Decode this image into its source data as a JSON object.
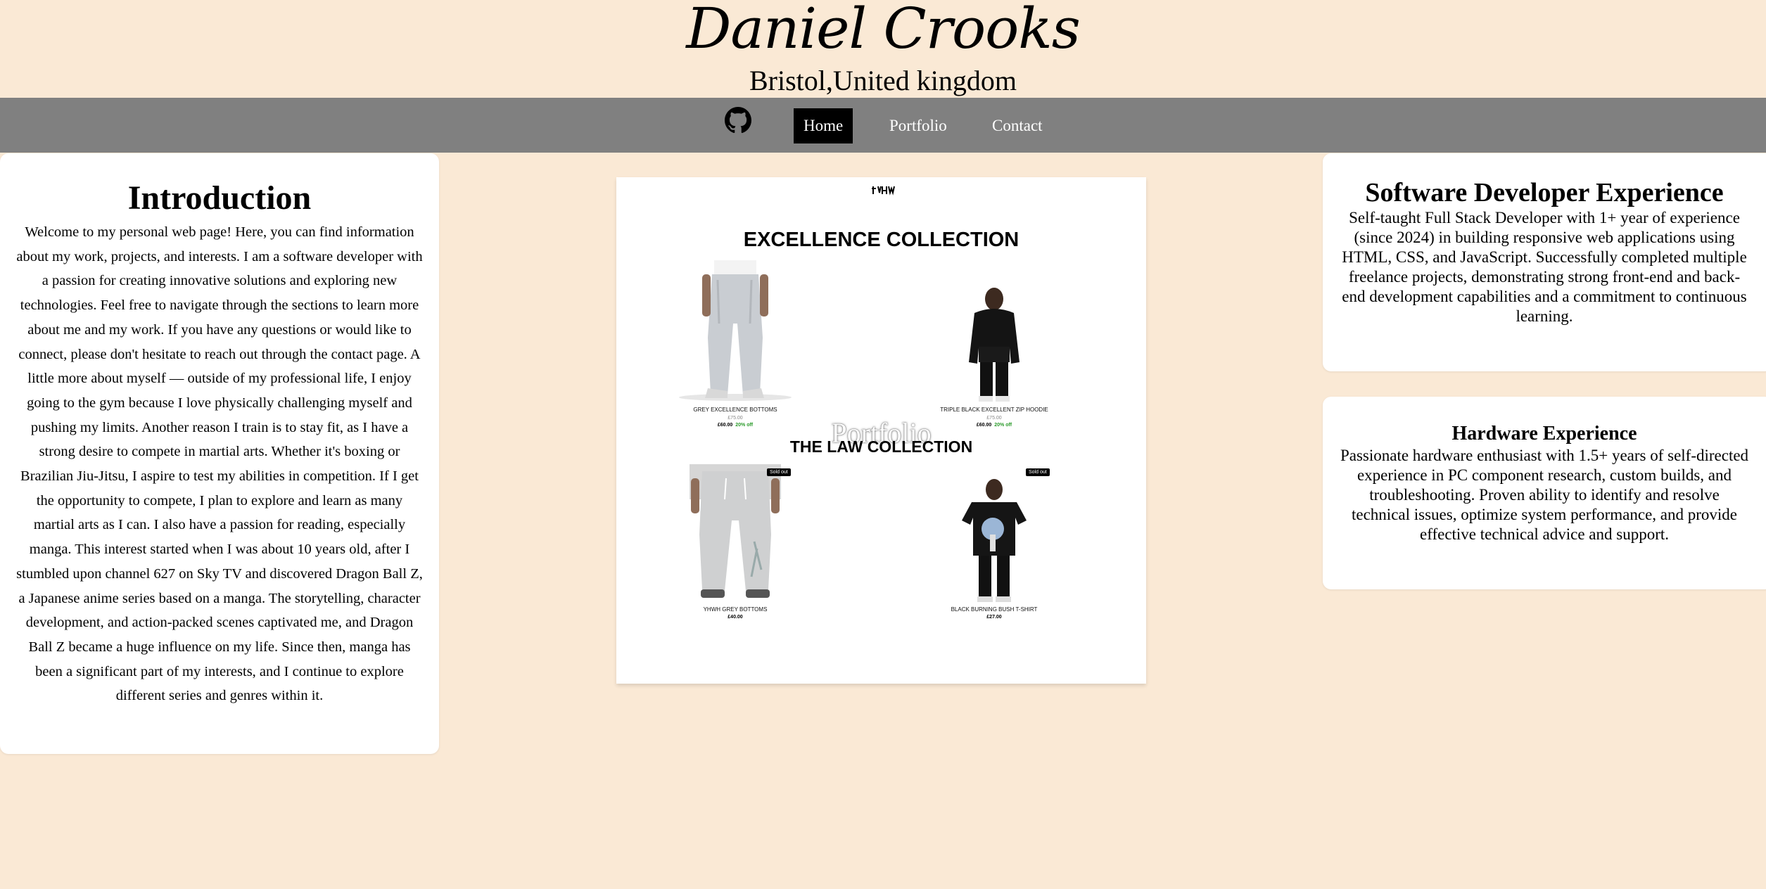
{
  "header": {
    "name": "Daniel Crooks",
    "location": "Bristol,United kingdom"
  },
  "nav": {
    "github_icon": "github-icon",
    "items": [
      "Home",
      "Portfolio",
      "Contact"
    ],
    "active": "Home"
  },
  "intro": {
    "title": "Introduction",
    "body": "Welcome to my personal web page! Here, you can find information about my work, projects, and interests. I am a software developer with a passion for creating innovative solutions and exploring new technologies. Feel free to navigate through the sections to learn more about me and my work. If you have any questions or would like to connect, please don't hesitate to reach out through the contact page. A little more about myself — outside of my professional life, I enjoy going to the gym because I love physically challenging myself and pushing my limits. Another reason I train is to stay fit, as I have a strong desire to compete in martial arts. Whether it's boxing or Brazilian Jiu-Jitsu, I aspire to test my abilities in competition. If I get the opportunity to compete, I plan to explore and learn as many martial arts as I can. I also have a passion for reading, especially manga. This interest started when I was about 10 years old, after I stumbled upon channel 627 on Sky TV and discovered Dragon Ball Z, a Japanese anime series based on a manga. The storytelling, character development, and action-packed scenes captivated me, and Dragon Ball Z became a huge influence on my life. Since then, manga has been a significant part of my interests, and I continue to explore different series and genres within it."
  },
  "software": {
    "title": "Software Developer Experience",
    "body": "Self-taught Full Stack Developer with 1+ year of experience (since 2024) in building responsive web applications using HTML, CSS, and JavaScript. Successfully completed multiple freelance projects, demonstrating strong front-end and back-end development capabilities and a commitment to continuous learning."
  },
  "hardware": {
    "title": "Hardware Experience",
    "body": "Passionate hardware enthusiast with 1.5+ years of self-directed experience in PC component research, custom builds, and troubleshooting. Proven ability to identify and resolve technical issues, optimize system performance, and provide effective technical advice and support."
  },
  "portfolio_preview": {
    "overlay_label": "Portfolio",
    "logo_text": "YHWH",
    "collection1": {
      "title": "EXCELLENCE COLLECTION",
      "products": [
        {
          "name": "GREY EXCELLENCE BOTTOMS",
          "old_price": "£75.00",
          "price": "£60.00",
          "discount": "20% off"
        },
        {
          "name": "TRIPLE BLACK EXCELLENT ZIP HOODIE",
          "old_price": "£75.00",
          "price": "£60.00",
          "discount": "20% off"
        }
      ]
    },
    "collection2": {
      "title": "THE LAW COLLECTION",
      "products": [
        {
          "name": "YHWH GREY BOTTOMS",
          "price": "£40.00",
          "badge": "Sold out"
        },
        {
          "name": "BLACK BURNING BUSH T-SHIRT",
          "price": "£27.00",
          "badge": "Sold out"
        }
      ]
    }
  },
  "colors": {
    "background": "#fae9d5",
    "nav": "#808080",
    "active_nav": "#000000",
    "card": "#ffffff",
    "discount": "#2a9a2a"
  }
}
